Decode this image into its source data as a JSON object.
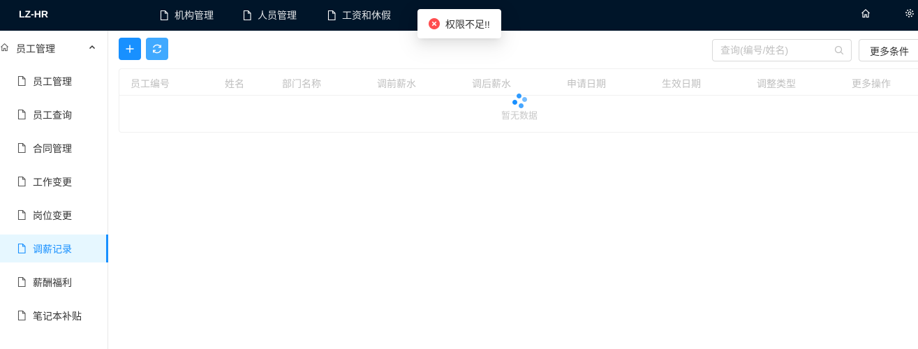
{
  "app": {
    "logo": "LZ-HR"
  },
  "topnav": [
    {
      "label": "机构管理"
    },
    {
      "label": "人员管理"
    },
    {
      "label": "工资和休假"
    }
  ],
  "sidebar": {
    "submenu_title": "员工管理",
    "items": [
      {
        "label": "员工管理"
      },
      {
        "label": "员工查询"
      },
      {
        "label": "合同管理"
      },
      {
        "label": "工作变更"
      },
      {
        "label": "岗位变更"
      },
      {
        "label": "调薪记录",
        "active": true
      },
      {
        "label": "薪酬福利"
      },
      {
        "label": "笔记本补贴"
      }
    ]
  },
  "toolbar": {
    "search_placeholder": "查询(编号/姓名)",
    "more_label": "更多条件"
  },
  "table": {
    "columns": [
      "员工编号",
      "姓名",
      "部门名称",
      "调前薪水",
      "调后薪水",
      "申请日期",
      "生效日期",
      "调整类型",
      "更多操作"
    ],
    "empty_text": "暂无数据"
  },
  "toast": {
    "message": "权限不足!!",
    "type": "error"
  },
  "colors": {
    "header_bg": "#001529",
    "primary": "#1890ff",
    "active_bg": "#e6f7ff",
    "error": "#ff4d4f"
  }
}
